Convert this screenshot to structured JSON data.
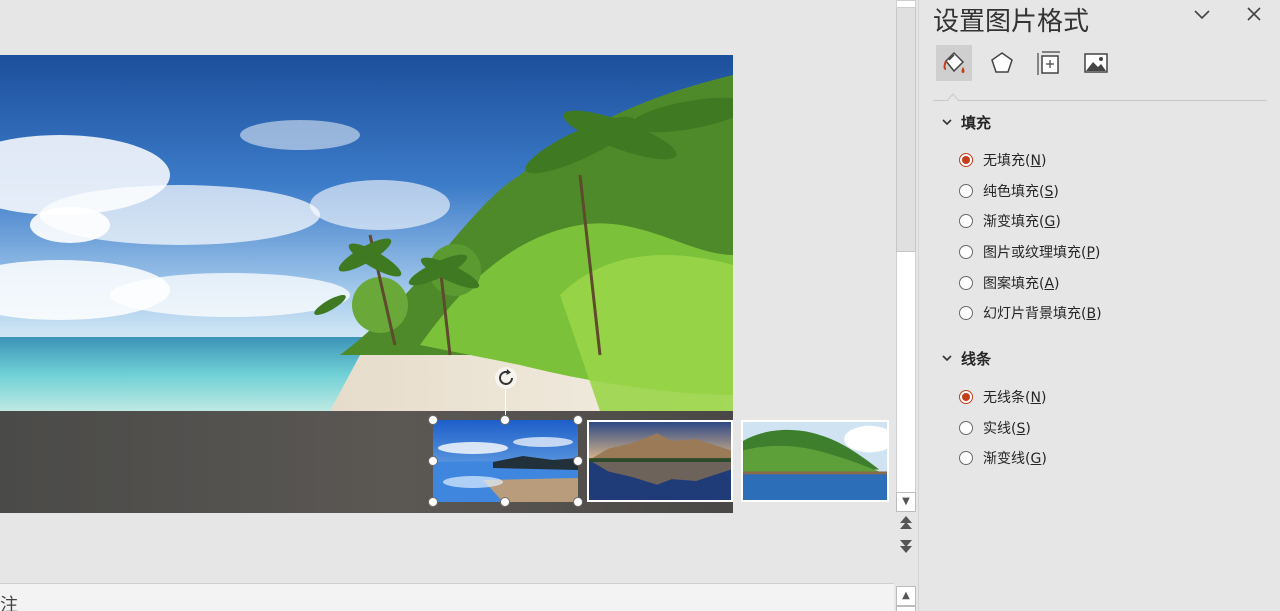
{
  "notes": {
    "label": "注"
  },
  "pane": {
    "title": "设置图片格式",
    "tabs": [
      {
        "name": "fill-and-line",
        "icon": "paint-bucket-icon",
        "selected": true
      },
      {
        "name": "effects",
        "icon": "pentagon-icon",
        "selected": false
      },
      {
        "name": "size-and-properties",
        "icon": "size-properties-icon",
        "selected": false
      },
      {
        "name": "picture",
        "icon": "picture-icon",
        "selected": false
      }
    ],
    "fill": {
      "header": "填充",
      "options": [
        {
          "text": "无填充(",
          "key": "N",
          "close": ")",
          "checked": true
        },
        {
          "text": "纯色填充(",
          "key": "S",
          "close": ")",
          "checked": false
        },
        {
          "text": "渐变填充(",
          "key": "G",
          "close": ")",
          "checked": false
        },
        {
          "text": "图片或纹理填充(",
          "key": "P",
          "close": ")",
          "checked": false
        },
        {
          "text": "图案填充(",
          "key": "A",
          "close": ")",
          "checked": false
        },
        {
          "text": "幻灯片背景填充(",
          "key": "B",
          "close": ")",
          "checked": false
        }
      ]
    },
    "line": {
      "header": "线条",
      "options": [
        {
          "text": "无线条(",
          "key": "N",
          "close": ")",
          "checked": true
        },
        {
          "text": "实线(",
          "key": "S",
          "close": ")",
          "checked": false
        },
        {
          "text": "渐变线(",
          "key": "G",
          "close": ")",
          "checked": false
        }
      ]
    }
  },
  "colors": {
    "accent": "#c43e1c",
    "pane_bg": "#e6e6e6",
    "selected_tab_bg": "#cfcfcf"
  }
}
